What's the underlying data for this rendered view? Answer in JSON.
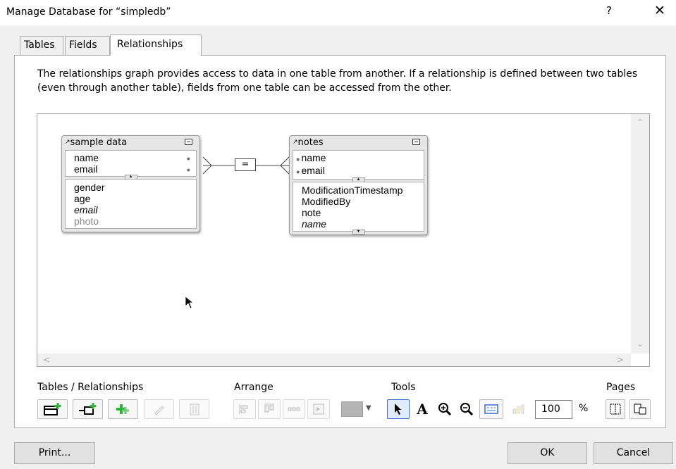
{
  "window": {
    "title": "Manage Database for “simpledb”",
    "help_label": "?",
    "close_label": "✕"
  },
  "tabs": [
    {
      "label": "Tables",
      "active": false
    },
    {
      "label": "Fields",
      "active": false
    },
    {
      "label": "Relationships",
      "active": true
    }
  ],
  "description": "The relationships graph provides access to data in one table from another. If a relationship is defined between two tables (even through another table), fields from one table can be accessed from the other.",
  "graph": {
    "tables": [
      {
        "name": "sample data",
        "match_fields": [
          "name",
          "email"
        ],
        "other_fields": [
          {
            "label": "gender",
            "style": "normal"
          },
          {
            "label": "age",
            "style": "normal"
          },
          {
            "label": "email",
            "style": "italic"
          },
          {
            "label": "photo",
            "style": "gray"
          }
        ]
      },
      {
        "name": "notes",
        "match_fields": [
          "name",
          "email"
        ],
        "other_fields": [
          {
            "label": "ModificationTimestamp",
            "style": "normal"
          },
          {
            "label": "ModifiedBy",
            "style": "normal"
          },
          {
            "label": "note",
            "style": "normal"
          },
          {
            "label": "name",
            "style": "italic"
          }
        ]
      }
    ],
    "relationship_operator": "="
  },
  "toolbar": {
    "groups": {
      "tables_relationships": "Tables / Relationships",
      "arrange": "Arrange",
      "tools": "Tools",
      "pages": "Pages"
    },
    "zoom_value": "100",
    "zoom_unit": "%",
    "color_swatch": "#b4b4b4",
    "accent": "#3a6ad4",
    "add_icon_color": "#2fb536"
  },
  "buttons": {
    "print": "Print...",
    "ok": "OK",
    "cancel": "Cancel"
  }
}
